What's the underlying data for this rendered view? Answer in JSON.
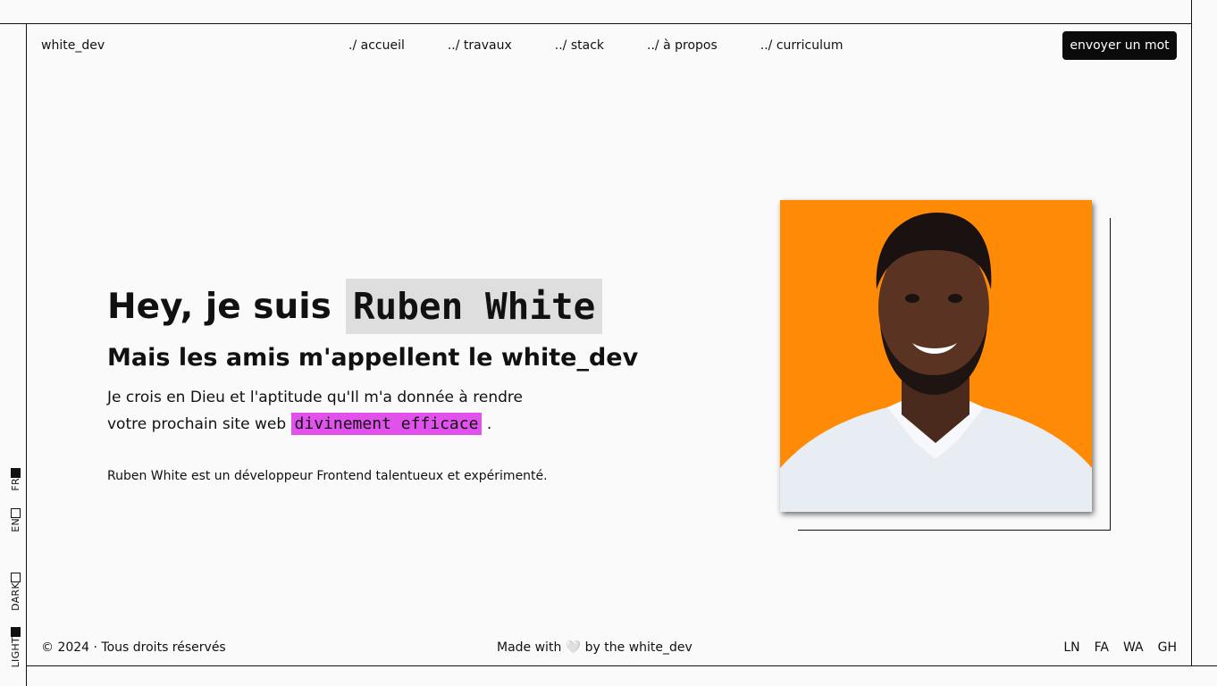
{
  "header": {
    "brand": "white_dev",
    "nav": [
      {
        "label": "./ accueil"
      },
      {
        "label": "../ travaux"
      },
      {
        "label": "../ stack"
      },
      {
        "label": "../ à propos"
      },
      {
        "label": "../ curriculum"
      }
    ],
    "cta_label": "envoyer un mot"
  },
  "side": {
    "language": [
      {
        "label": "FR",
        "active": true
      },
      {
        "label": "EN",
        "active": false
      }
    ],
    "theme": [
      {
        "label": "DARK",
        "active": false
      },
      {
        "label": "LIGHT",
        "active": true
      }
    ]
  },
  "hero": {
    "greeting": "Hey, je suis",
    "name": "Ruben White",
    "subtitle": "Mais les amis m'appellent le white_dev",
    "line1": "Je crois en Dieu et l'aptitude qu'Il m'a donnée à rendre",
    "line2_pre": "votre prochain site web",
    "highlight": "divinement efficace",
    "line2_post": ".",
    "note": "Ruben White est un développeur Frontend talentueux et expérimenté."
  },
  "colors": {
    "highlight": "#e151ec",
    "name_bg": "#dedede",
    "photo_bg": "#ff8a05",
    "cta_bg": "#0b0b0b"
  },
  "footer": {
    "copyright": "© 2024 · Tous droits réservés",
    "made_with": "Made with 🤍 by the white_dev",
    "socials": [
      "LN",
      "FA",
      "WA",
      "GH"
    ]
  }
}
